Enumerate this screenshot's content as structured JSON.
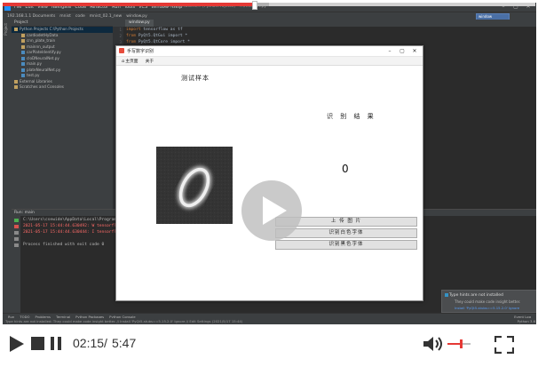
{
  "ide": {
    "menu": [
      "File",
      "Edit",
      "View",
      "Navigate",
      "Code",
      "Refactor",
      "Run",
      "Tools",
      "VCS",
      "Window",
      "Help"
    ],
    "window_title": "mnist.py - C:\\Users\\... [PythonProjects] - ...\\mnist_ff.py",
    "breadcrumbs": [
      "192.168.1.1 Documents",
      "mnist",
      "code",
      "mnist_02.1_new",
      "window.py"
    ],
    "run_config": "window",
    "project_header": "Project",
    "tree": [
      {
        "label": "Python Projects  C:\\Python Projects",
        "selected": true
      },
      {
        "label": "cardiodetHyData",
        "selected": false
      },
      {
        "label": "cnn_plate_train",
        "selected": false
      },
      {
        "label": "mainnn_output",
        "selected": false
      },
      {
        "label": "carPlateIdentify.py",
        "selected": false
      },
      {
        "label": "cloDNeuralNet.py",
        "selected": false
      },
      {
        "label": "main.py",
        "selected": false
      },
      {
        "label": "plateNeuralNet.py",
        "selected": false
      },
      {
        "label": "test.py",
        "selected": false
      },
      {
        "label": "External Libraries",
        "selected": false
      },
      {
        "label": "Scratches and Consoles",
        "selected": false
      }
    ],
    "editor_tab": "window.py",
    "code_lines": [
      {
        "kw": "import",
        "rest": " tensorflow as tf"
      },
      {
        "kw": "from",
        "rest": " PyQt5.QtGui import *"
      },
      {
        "kw": "from",
        "rest": " PyQt5.QtCore import *"
      }
    ],
    "run_header": "Run:   main",
    "console": [
      {
        "text": "C:\\Users\\csewide\\AppData\\Local\\Programs\\...",
        "err": false
      },
      {
        "text": "2021-05-17 15:44:44.630492: W tensorflow/...",
        "err": true
      },
      {
        "text": "2021-05-17 15:44:44.630444: I tensorflow/...",
        "err": true
      },
      {
        "text": "",
        "err": false
      },
      {
        "text": "Process finished with exit code 0",
        "err": false
      }
    ],
    "tool_tabs": [
      "Run",
      "TODO",
      "Problems",
      "Terminal",
      "Python Packages",
      "Python Console"
    ],
    "event_log": "Event Log",
    "status_text": "Type hints are not installed: They could make code insight better. // Install 'PyQt5-stubs==5.15.2.0'  Ignore // Edit Settings (2021/5/17 15:44)",
    "status_right": "Python 3.6",
    "notification": {
      "title": "Type hints are not installed",
      "body": "They could make code insight better.",
      "link": "Install 'PyQt5-stubs==5.15.2.0'   Ignore"
    }
  },
  "app": {
    "title": "手写数字识别",
    "tabs": [
      {
        "icon": "⌂",
        "label": "主页面"
      },
      {
        "icon": "",
        "label": "关于"
      }
    ],
    "sample_label": "测试样本",
    "result_label": "识 别 结 果",
    "result_value": "0",
    "buttons": [
      "上 传 图 片",
      "识别白色字体",
      "识别黑色字体"
    ]
  },
  "player": {
    "time_current": "02:15",
    "time_separator": "/",
    "time_total": "5:47",
    "progress": 0.472,
    "volume": 0.55,
    "accent": "#e53935"
  }
}
